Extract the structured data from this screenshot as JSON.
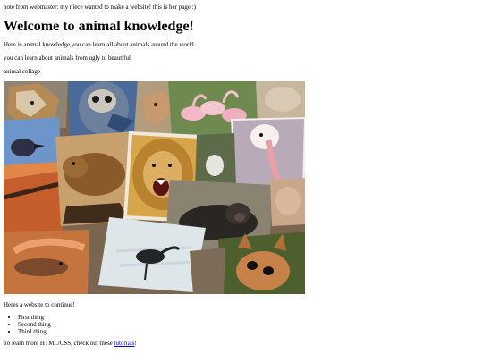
{
  "note": "note from webmaster: my niece wanted to make a website! this is her page :)",
  "heading": "Welcome to animal knowledge!",
  "intro": "Here in animal knowledge,you can learn all about animals around the world.",
  "subintro": "you can learn about animals from ugly to beautiful",
  "collage_label": "animal collage",
  "collage_photos": [
    "fox",
    "owl",
    "deer",
    "pink-flamingos",
    "bird",
    "capybara",
    "lion",
    "pelican",
    "gorilla",
    "heron",
    "lizard",
    "fawn"
  ],
  "continue_text": "Heres a website to continue!",
  "list_items": [
    "First thing",
    "Second thing",
    "Third thing"
  ],
  "footer_text": "To learn more HTML/CSS, check out these ",
  "footer_link": "tutorials",
  "footer_end": "!"
}
